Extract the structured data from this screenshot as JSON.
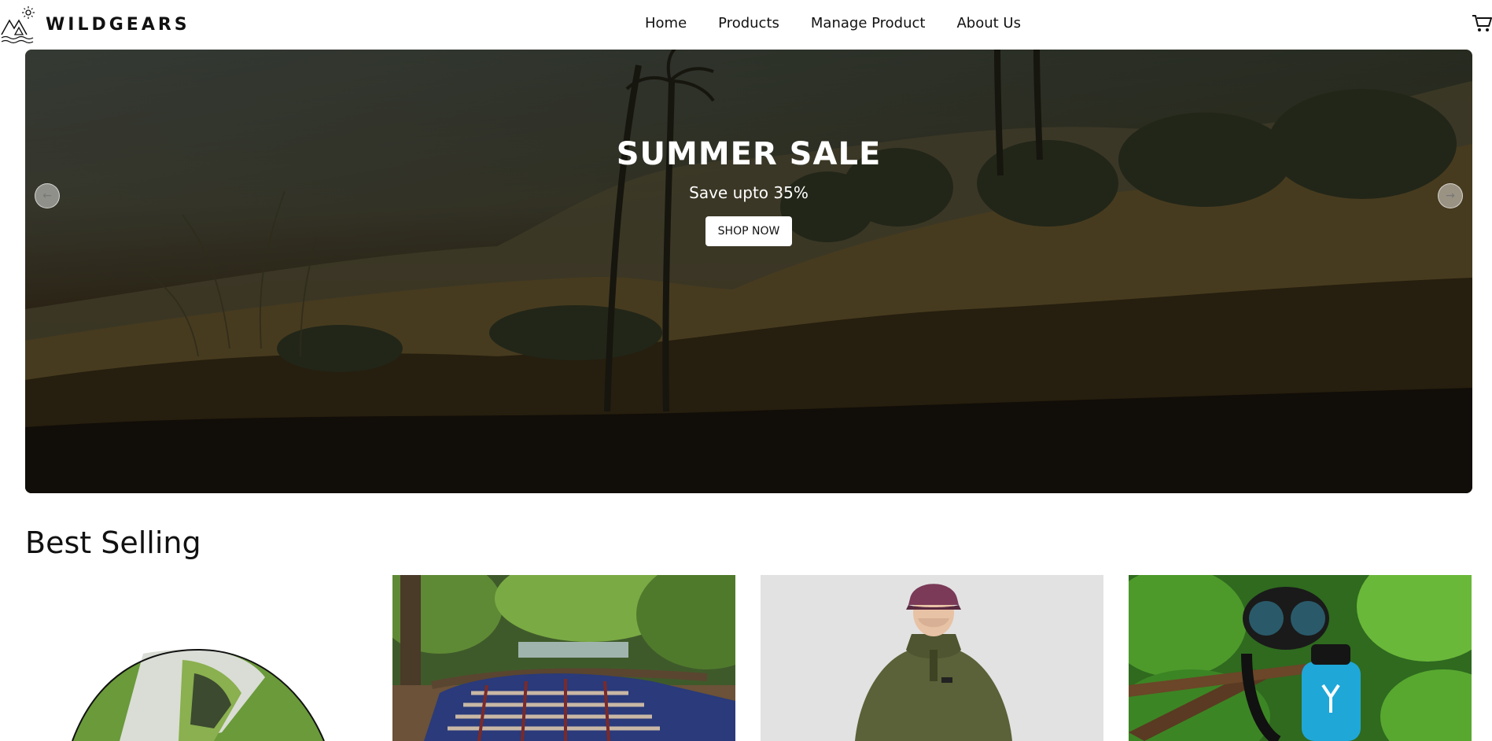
{
  "brand": {
    "name": "WILDGEARS",
    "logo_icon": "mountain-sun-logo"
  },
  "nav": {
    "items": [
      {
        "label": "Home"
      },
      {
        "label": "Products"
      },
      {
        "label": "Manage Product"
      },
      {
        "label": "About Us"
      }
    ],
    "cart_icon": "cart-icon"
  },
  "hero": {
    "title": "SUMMER SALE",
    "subtitle": "Save upto 35%",
    "cta_label": "SHOP NOW",
    "prev_icon": "arrow-left-icon",
    "next_icon": "arrow-right-icon"
  },
  "best_selling": {
    "title": "Best Selling",
    "products": [
      {
        "image": "tent-image"
      },
      {
        "image": "sleeping-bag-image"
      },
      {
        "image": "fleece-hoodie-image"
      },
      {
        "image": "water-bottle-snorkel-image"
      }
    ]
  }
}
